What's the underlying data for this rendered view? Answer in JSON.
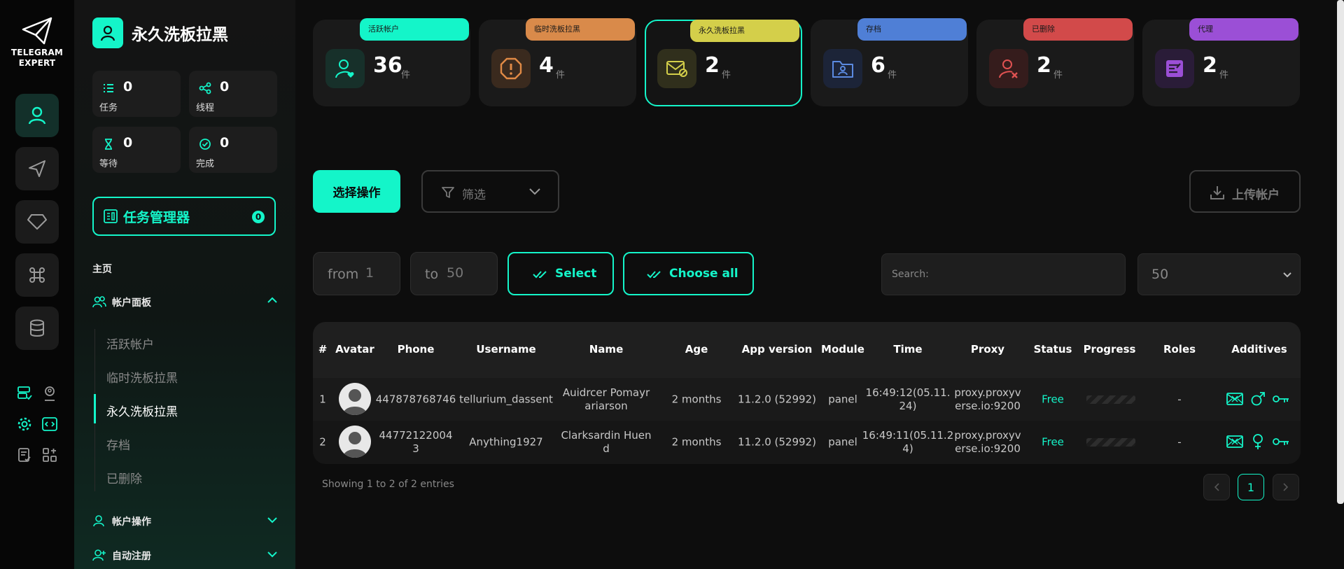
{
  "brand": {
    "logo_line1": "TELEGRAM",
    "logo_line2": "EXPERT",
    "title": "永久洗板拉黑"
  },
  "stats": [
    {
      "value": "0",
      "label": "任务"
    },
    {
      "value": "0",
      "label": "线程"
    },
    {
      "value": "0",
      "label": "等待"
    },
    {
      "value": "0",
      "label": "完成"
    }
  ],
  "task_manager": {
    "label": "任务管理器",
    "badge": "0"
  },
  "nav": {
    "home": "主页",
    "account_panel": "帐户面板",
    "sub_items": [
      "活跃帐户",
      "临时洗板拉黑",
      "永久洗板拉黑",
      "存档",
      "已删除"
    ],
    "account_ops": "帐户操作",
    "auto_register": "自动注册"
  },
  "cards": [
    {
      "tag": "活跃帐户",
      "count": "36",
      "unit": "件",
      "color": "#14f5c9"
    },
    {
      "tag": "临时洗板拉黑",
      "count": "4",
      "unit": "件",
      "color": "#d98a4a"
    },
    {
      "tag": "永久洗板拉黑",
      "count": "2",
      "unit": "件",
      "color": "#d4cf4a"
    },
    {
      "tag": "存档",
      "count": "6",
      "unit": "件",
      "color": "#4f7fd6"
    },
    {
      "tag": "已删除",
      "count": "2",
      "unit": "件",
      "color": "#d24a4a"
    },
    {
      "tag": "代理",
      "count": "2",
      "unit": "件",
      "color": "#9b4fd6"
    }
  ],
  "toolbar": {
    "select_action": "选择操作",
    "filter": "筛选",
    "upload": "上传帐户"
  },
  "range": {
    "from_label": "from",
    "from_value": "1",
    "to_label": "to",
    "to_value": "50",
    "select": "Select",
    "choose_all": "Choose all"
  },
  "search": {
    "placeholder": "Search:"
  },
  "page_size": "50",
  "table": {
    "headers": [
      "#",
      "Avatar",
      "Phone",
      "Username",
      "Name",
      "Age",
      "App version",
      "Module",
      "Time",
      "Proxy",
      "Status",
      "Progress",
      "Roles",
      "Additives"
    ],
    "rows": [
      {
        "num": "1",
        "phone": "447878768746",
        "username": "tellurium_dassent",
        "name_l1": "Auidrcer Pomayr",
        "name_l2": "ariarson",
        "age": "2 months",
        "app_version": "11.2.0 (52992)",
        "module": "panel",
        "time_l1": "16:49:12(05.11.",
        "time_l2": "24)",
        "proxy_l1": "proxy.proxyv",
        "proxy_l2": "erse.io:9200",
        "status": "Free",
        "roles": "-"
      },
      {
        "num": "2",
        "phone_l1": "44772122004",
        "phone_l2": "3",
        "username": "Anything1927",
        "name_l1": "Clarksardin Huen",
        "name_l2": "d",
        "age": "2 months",
        "app_version": "11.2.0 (52992)",
        "module": "panel",
        "time_l1": "16:49:11(05.11.2",
        "time_l2": "4)",
        "proxy_l1": "proxy.proxyv",
        "proxy_l2": "erse.io:9200",
        "status": "Free",
        "roles": "-"
      }
    ]
  },
  "footer": {
    "showing": "Showing 1 to 2 of 2 entries",
    "page": "1"
  },
  "colors": {
    "accent": "#14f5c9",
    "background": "#0d0d0d"
  }
}
